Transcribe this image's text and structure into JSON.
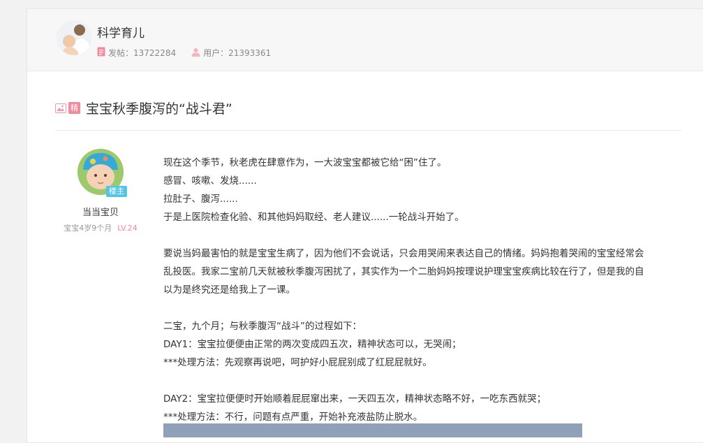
{
  "forum": {
    "name": "科学育儿",
    "posts_label": "发帖：",
    "posts_count": "13722284",
    "users_label": "用户：",
    "users_count": "21393361"
  },
  "post": {
    "badge": "精",
    "title": "宝宝秋季腹泻的“战斗君”"
  },
  "author": {
    "tag": "楼主",
    "name": "当当宝贝",
    "baby_age": "宝宝4岁9个月",
    "level": "LV.24"
  },
  "content": {
    "p1": "现在这个季节，秋老虎在肆意作为，一大波宝宝都被它给“困”住了。",
    "p2": "感冒、咳嗽、发烧......",
    "p3": "拉肚子、腹泻......",
    "p4": "于是上医院检查化验、和其他妈妈取经、老人建议......一轮战斗开始了。",
    "p5": "要说当妈最害怕的就是宝宝生病了，因为他们不会说话，只会用哭闹来表达自己的情绪。妈妈抱着哭闹的宝宝经常会乱投医。我家二宝前几天就被秋季腹泻困扰了，其实作为一个二胎妈妈按理说护理宝宝疾病比较在行了，但是我的自以为是终究还是给我上了一课。",
    "p6": "二宝，九个月；与秋季腹泻“战斗”的过程如下：",
    "p7": "DAY1：宝宝拉便便由正常的两次变成四五次，精神状态可以，无哭闹；",
    "p8": "***处理方法：先观察再说吧，呵护好小屁屁别成了红屁屁就好。",
    "p9": "DAY2：宝宝拉便便时开始顺着屁屁窜出来，一天四五次，精神状态略不好，一吃东西就哭；",
    "p10": "***处理方法：不行，问题有点严重，开始补充液盐防止脱水。"
  }
}
